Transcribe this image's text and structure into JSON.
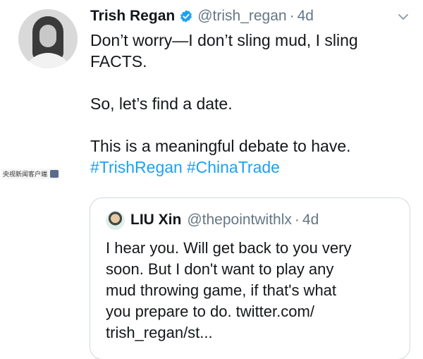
{
  "tweet": {
    "author": {
      "name": "Trish Regan",
      "handle": "@trish_regan",
      "verified": true
    },
    "separator": "·",
    "time": "4d",
    "body_lines": [
      "Don’t worry—I don’t sling mud, I sling",
      "FACTS.",
      "So, let’s find a date.",
      "This is a meaningful debate to have."
    ],
    "hashtags": [
      "#TrishRegan",
      "#ChinaTrade"
    ],
    "link_color": "#1da1f2",
    "verified_color": "#1da1f2"
  },
  "quote": {
    "author": {
      "name": "LIU Xin",
      "handle": "@thepointwithlx"
    },
    "separator": "·",
    "time": "4d",
    "body_lines": [
      "I hear you. Will get back to you very",
      "soon. But I don't want to play any",
      "mud throwing game, if that's what",
      "you prepare to do. twitter.com/",
      "trish_regan/st..."
    ]
  },
  "watermark": {
    "text": "央视新闻客户端"
  },
  "icons": {
    "verified": "verified-badge-icon",
    "more": "chevron-down-icon"
  }
}
